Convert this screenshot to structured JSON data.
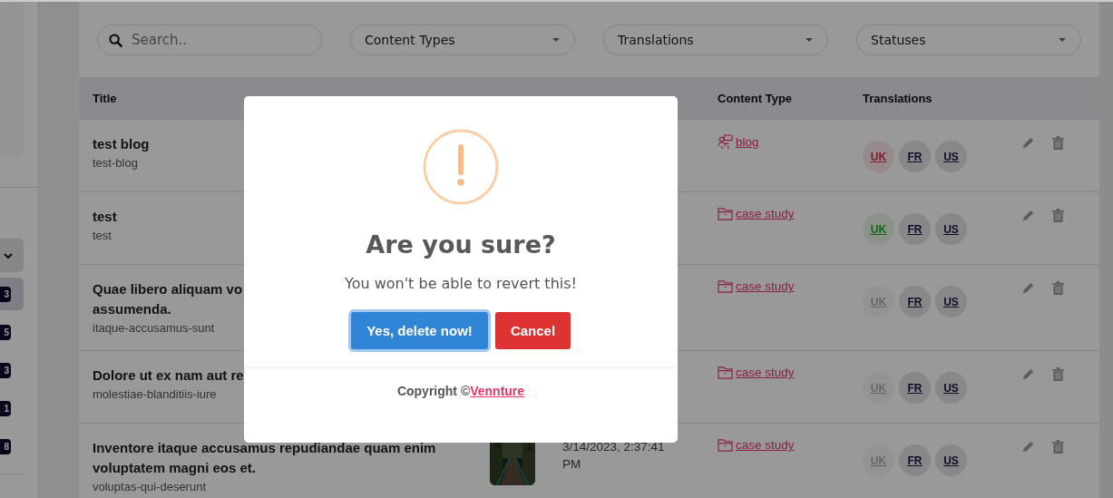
{
  "sidebar": {
    "items": [
      {
        "count": "3",
        "selected": true
      },
      {
        "count": "5",
        "selected": false
      },
      {
        "count": "3",
        "selected": false
      },
      {
        "count": "1",
        "selected": false
      },
      {
        "count": "8",
        "selected": false
      }
    ]
  },
  "filters": {
    "search": {
      "placeholder": "Search.."
    },
    "dropdowns": [
      "Content Types",
      "Translations",
      "Statuses"
    ]
  },
  "table": {
    "columns": [
      {
        "label": "Title"
      },
      {
        "label": "Content Type"
      },
      {
        "label": "Translations"
      }
    ],
    "rows": [
      {
        "title_lines": [
          "test blog"
        ],
        "slug": "test-blog",
        "content_type": {
          "kind": "blog",
          "label": "blog"
        },
        "translations": [
          {
            "label": "UK",
            "color": "#821d2f"
          },
          {
            "label": "FR",
            "color": "#0c0c24"
          },
          {
            "label": "US",
            "color": "#0c0c24"
          }
        ]
      },
      {
        "title_lines": [
          "test"
        ],
        "slug": "test",
        "content_type": {
          "kind": "case_study",
          "label": "case study"
        },
        "translations": [
          {
            "label": "UK",
            "color": "#14651a"
          },
          {
            "label": "FR",
            "color": "#0c0c24"
          },
          {
            "label": "US",
            "color": "#0c0c24"
          }
        ]
      },
      {
        "title_lines": [
          "Quae libero aliquam vo",
          "assumenda."
        ],
        "slug": "itaque-accusamus-sunt",
        "content_type": {
          "kind": "case_study",
          "label": "case study"
        },
        "translations": [
          {
            "label": "UK",
            "color": "#65656c"
          },
          {
            "label": "FR",
            "color": "#0c0c24"
          },
          {
            "label": "US",
            "color": "#0c0c24"
          }
        ]
      },
      {
        "title_lines": [
          "Dolore ut ex nam aut re"
        ],
        "slug": "molestiae-blanditiis-iure",
        "content_type": {
          "kind": "case_study",
          "label": "case study"
        },
        "translations": [
          {
            "label": "UK",
            "color": "#65656c"
          },
          {
            "label": "FR",
            "color": "#0c0c24"
          },
          {
            "label": "US",
            "color": "#0c0c24"
          }
        ]
      },
      {
        "title_lines": [
          "Inventore itaque accusamus repudiandae quam enim voluptatem magni eos et."
        ],
        "slug": "voluptas-qui-deserunt",
        "thumbnail": {
          "kind": "picture"
        },
        "date": "3/14/2023, 2:37:41 PM",
        "content_type": {
          "kind": "case_study",
          "label": "case study"
        },
        "translations": [
          {
            "label": "UK",
            "color": "#65656c"
          },
          {
            "label": "FR",
            "color": "#0c0c24"
          },
          {
            "label": "US",
            "color": "#0c0c24"
          }
        ]
      }
    ]
  },
  "dialog": {
    "title": "Are you sure?",
    "message": "You won't be able to revert this!",
    "confirm": "Yes, delete now!",
    "cancel": "Cancel",
    "footer_text": "Copyright ©",
    "footer_link": "Vennture"
  }
}
